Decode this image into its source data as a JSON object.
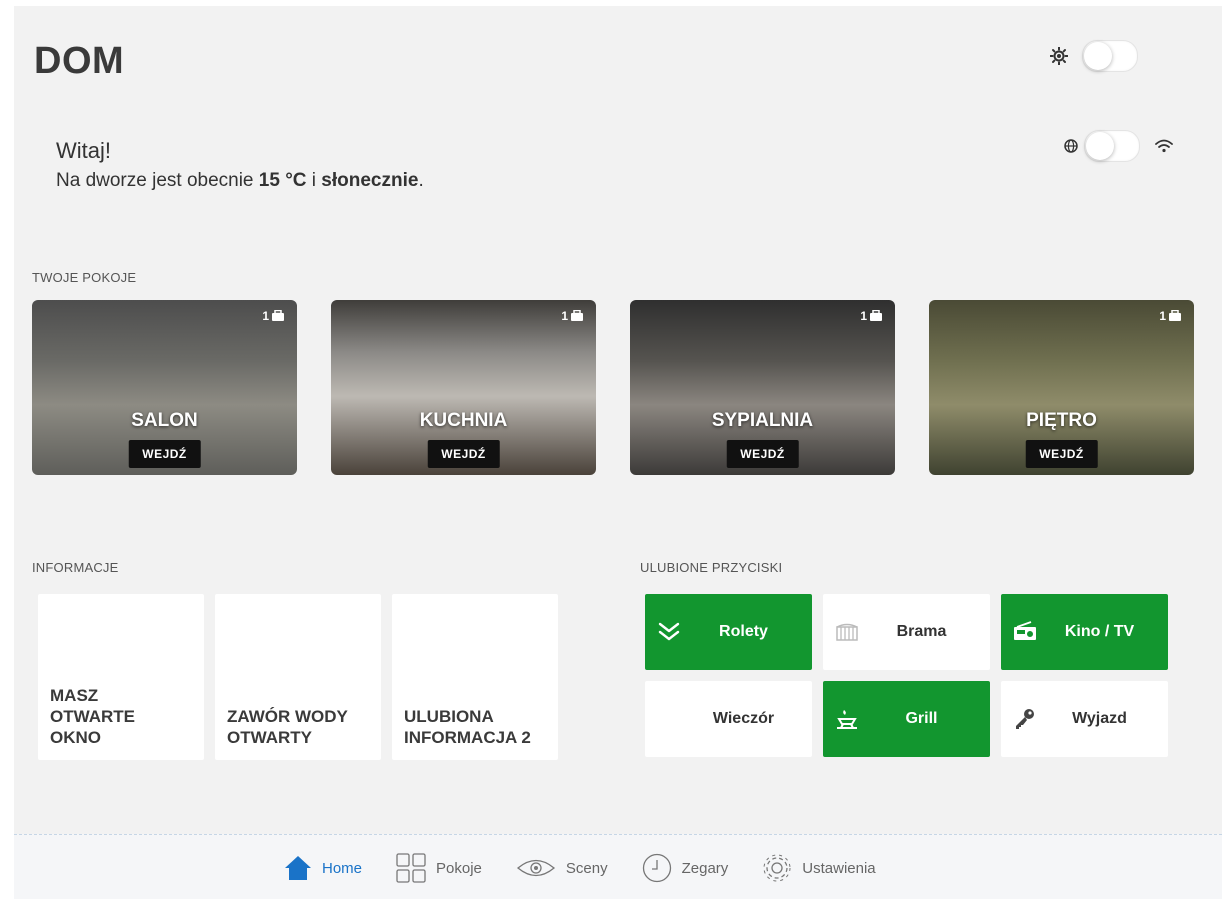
{
  "header": {
    "title": "DOM"
  },
  "welcome": {
    "greeting": "Witaj!",
    "weather_prefix": "Na dworze jest obecnie ",
    "temperature": "15 °C",
    "weather_mid": " i ",
    "condition": "słonecznie",
    "weather_suffix": "."
  },
  "rooms": {
    "label": "TWOJE POKOJE",
    "items": [
      {
        "name": "SALON",
        "count": "1",
        "action": "WEJDŹ"
      },
      {
        "name": "KUCHNIA",
        "count": "1",
        "action": "WEJDŹ"
      },
      {
        "name": "SYPIALNIA",
        "count": "1",
        "action": "WEJDŹ"
      },
      {
        "name": "PIĘTRO",
        "count": "1",
        "action": "WEJDŹ"
      }
    ]
  },
  "info": {
    "label": "INFORMACJE",
    "items": [
      {
        "text": "MASZ\nOTWARTE\nOKNO"
      },
      {
        "text": "ZAWÓR WODY\nOTWARTY"
      },
      {
        "text": "ULUBIONA\nINFORMACJA 2"
      }
    ]
  },
  "favorites": {
    "label": "ULUBIONE PRZYCISKI",
    "items": [
      {
        "label": "Rolety",
        "icon": "double-chevron-down-icon",
        "active": true
      },
      {
        "label": "Brama",
        "icon": "gate-icon",
        "active": false
      },
      {
        "label": "Kino / TV",
        "icon": "radio-icon",
        "active": true
      },
      {
        "label": "Wieczór",
        "icon": "moon-icon",
        "active": false
      },
      {
        "label": "Grill",
        "icon": "grill-icon",
        "active": true
      },
      {
        "label": "Wyjazd",
        "icon": "key-icon",
        "active": false
      }
    ]
  },
  "nav": {
    "items": [
      {
        "label": "Home",
        "icon": "home-icon",
        "active": true
      },
      {
        "label": "Pokoje",
        "icon": "grid-icon",
        "active": false
      },
      {
        "label": "Sceny",
        "icon": "eye-icon",
        "active": false
      },
      {
        "label": "Zegary",
        "icon": "clock-icon",
        "active": false
      },
      {
        "label": "Ustawienia",
        "icon": "gear-icon",
        "active": false
      }
    ]
  },
  "colors": {
    "accent_green": "#12962f",
    "nav_active": "#1a73c8"
  }
}
